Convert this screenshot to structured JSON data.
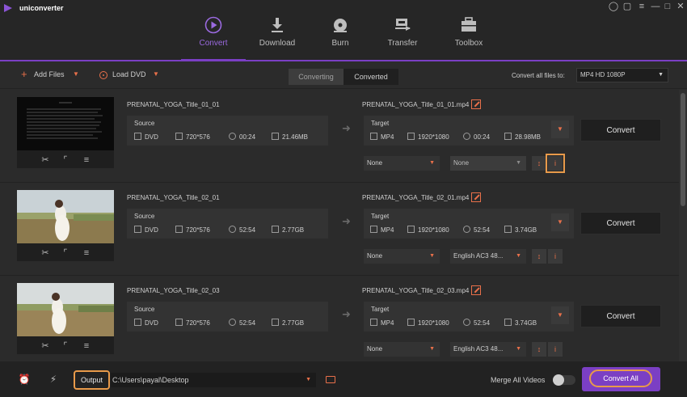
{
  "app": {
    "name": "uniconverter"
  },
  "nav": [
    {
      "label": "Convert",
      "icon": "convert-icon",
      "active": true
    },
    {
      "label": "Download",
      "icon": "download-icon"
    },
    {
      "label": "Burn",
      "icon": "burn-icon"
    },
    {
      "label": "Transfer",
      "icon": "transfer-icon"
    },
    {
      "label": "Toolbox",
      "icon": "toolbox-icon"
    }
  ],
  "toolbar": {
    "add_files": "Add Files",
    "load_dvd": "Load DVD",
    "tab_converting": "Converting",
    "tab_converted": "Converted",
    "convert_all_to_label": "Convert all files to:",
    "format_value": "MP4 HD 1080P"
  },
  "files": [
    {
      "source_name": "PRENATAL_YOGA_Title_01_01",
      "target_name": "PRENATAL_YOGA_Title_01_01.mp4",
      "source": {
        "title": "Source",
        "format": "DVD",
        "resolution": "720*576",
        "duration": "00:24",
        "size": "21.46MB"
      },
      "target": {
        "title": "Target",
        "format": "MP4",
        "resolution": "1920*1080",
        "duration": "00:24",
        "size": "28.98MB"
      },
      "subtitle": "None",
      "audio": "None",
      "convert_label": "Convert"
    },
    {
      "source_name": "PRENATAL_YOGA_Title_02_01",
      "target_name": "PRENATAL_YOGA_Title_02_01.mp4",
      "source": {
        "title": "Source",
        "format": "DVD",
        "resolution": "720*576",
        "duration": "52:54",
        "size": "2.77GB"
      },
      "target": {
        "title": "Target",
        "format": "MP4",
        "resolution": "1920*1080",
        "duration": "52:54",
        "size": "3.74GB"
      },
      "subtitle": "None",
      "audio": "English AC3 48...",
      "convert_label": "Convert"
    },
    {
      "source_name": "PRENATAL_YOGA_Title_02_03",
      "target_name": "PRENATAL_YOGA_Title_02_03.mp4",
      "source": {
        "title": "Source",
        "format": "DVD",
        "resolution": "720*576",
        "duration": "52:54",
        "size": "2.77GB"
      },
      "target": {
        "title": "Target",
        "format": "MP4",
        "resolution": "1920*1080",
        "duration": "52:54",
        "size": "3.74GB"
      },
      "subtitle": "None",
      "audio": "English AC3 48...",
      "convert_label": "Convert"
    }
  ],
  "bottom": {
    "output_label": "Output",
    "output_path": "C:\\Users\\payal\\Desktop",
    "merge_label": "Merge All Videos",
    "convert_all_label": "Convert All"
  },
  "colors": {
    "accent": "#7b3fc4",
    "orange": "#e8704a",
    "highlight": "#e89a4a"
  }
}
